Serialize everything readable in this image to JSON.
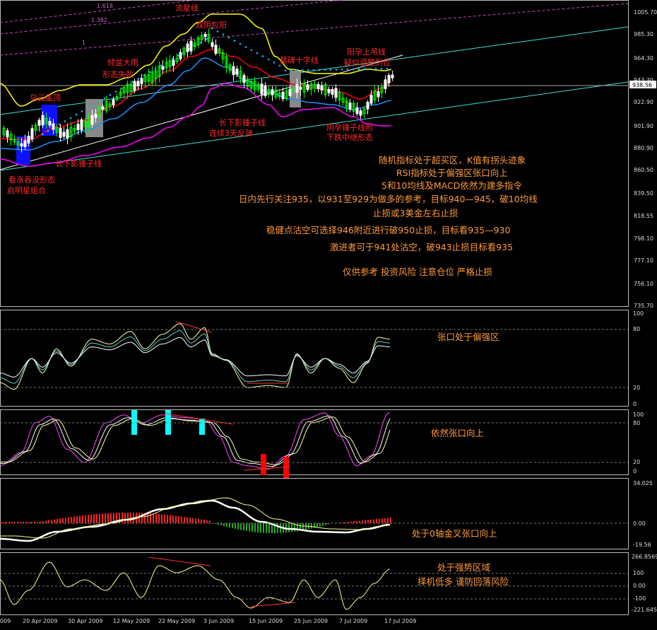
{
  "chart_data": [
    {
      "type": "line",
      "subtype": "candlestick",
      "panel": "price",
      "ylim": [
        735.0,
        1010.0
      ],
      "y_ticks": [
        "1005.70",
        "985.30",
        "964.30",
        "943.30",
        "922.90",
        "901.90",
        "880.90",
        "860.50",
        "839.50",
        "818.55",
        "798.10",
        "777.10",
        "756.10",
        "735.70"
      ],
      "last_price": "938.56",
      "fib_labels": [
        "1.618",
        "1.382",
        "1"
      ],
      "annotations": {
        "liuxing": "流星线",
        "shuangding": "双阴包阳",
        "wuyun": "乌云盖顶",
        "qingpen": "倾盆大雨",
        "xingtai": "形态失败",
        "mubei": "墓碑十字线",
        "yangyun": "阳孕上吊线",
        "jisi": "疑似调整到位",
        "hongyang": "看涨吞没形态",
        "qiming": "启明星组合",
        "chuiline": "长下影锤子线",
        "chuiline2": "长下影锤子线",
        "liangsan": "连续3天反弹",
        "yunchui": "阴孕锤子线附",
        "xiadie": "下跌中继形态"
      },
      "commentary": [
        "随机指标处于超买区，K值有拐头迹象",
        "RSI指标处于偏强区张口向上",
        "5和10均线及MACD依然为建多指令",
        "日内先行关注935，以931至929为做多的参考，目标940—945，破10均线",
        "止损或3美金左右止损",
        "稳健点沽空可选择946附近进行破950止损，目标看935—930",
        "激进者可于941处沽空，破943止损目标看935",
        "仅供参考 投资风险 注意仓位 严格止损"
      ]
    },
    {
      "type": "line",
      "panel": "RSI",
      "ylim": [
        0,
        100
      ],
      "y_ticks": [
        "100",
        "80",
        "20",
        "0"
      ],
      "note": "张口处于偏强区"
    },
    {
      "type": "line",
      "panel": "Stochastic",
      "ylim": [
        0,
        100
      ],
      "y_ticks": [
        "100",
        "80",
        "20",
        "0"
      ],
      "note": "依然张口向上"
    },
    {
      "type": "bar",
      "panel": "MACD",
      "ylim": [
        -19.56,
        34.025
      ],
      "y_ticks": [
        "34.025",
        "0.00",
        "-19.56"
      ],
      "note": "处于0轴金叉张口向上"
    },
    {
      "type": "line",
      "panel": "CCI",
      "ylim": [
        -221.645,
        266.8569
      ],
      "y_ticks": [
        "266.8569",
        "100",
        "0.00",
        "-100",
        "-221.645"
      ],
      "note1": "处于强势区域",
      "note2": "择机低多 谨防回落风险"
    }
  ],
  "x_axis": {
    "labels": [
      "009",
      "20 Apr 2009",
      "30 Apr 2009",
      "12 May 2009",
      "22 May 2009",
      "3 Jun 2009",
      "15 Jun 2009",
      "25 Jun 2009",
      "7 Jul 2009",
      "17 Jul 2009"
    ]
  },
  "colors": {
    "bull": "#00ff00",
    "bear": "#ffffff",
    "upper_band": "#ffff00",
    "lower_band": "#ff00ff",
    "ma_red": "#ff0000",
    "ma_blue": "#1e90ff",
    "sar": "#00bfff",
    "trend_cyan": "#40e0d0"
  }
}
